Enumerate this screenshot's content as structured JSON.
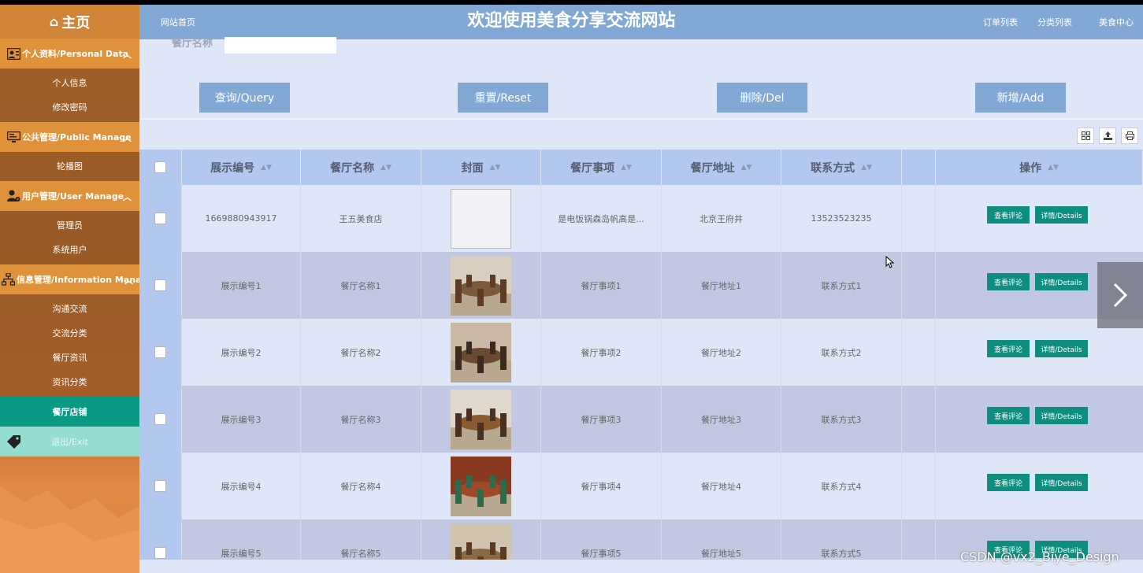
{
  "sidebar": {
    "home": "主页",
    "groups": [
      {
        "title": "个人资料/Personal Data",
        "items": [
          "个人信息",
          "修改密码"
        ]
      },
      {
        "title": "公共管理/Public Manage",
        "items": [
          "轮播图"
        ]
      },
      {
        "title": "用户管理/User Manage",
        "items": [
          "管理员",
          "系统用户"
        ]
      },
      {
        "title": "信息管理/Information Manage",
        "items": [
          "沟通交流",
          "交流分类",
          "餐厅资讯",
          "资讯分类"
        ]
      }
    ],
    "active": "餐厅店铺",
    "exit": "退出/Exit"
  },
  "header": {
    "home_link": "网站首页",
    "title": "欢迎使用美食分享交流网站",
    "links": [
      "订单列表",
      "分类列表",
      "美食中心"
    ]
  },
  "search": {
    "label": "餐厅名称",
    "value": ""
  },
  "buttons": {
    "query": "查询/Query",
    "reset": "重置/Reset",
    "delete": "删除/Del",
    "add": "新增/Add"
  },
  "table": {
    "headers": [
      "展示编号",
      "餐厅名称",
      "封面",
      "餐厅事项",
      "餐厅地址",
      "联系方式",
      "",
      "操作"
    ],
    "rows": [
      {
        "id": "1669880943917",
        "name": "王五美食店",
        "matter": "是电饭锅森岛帆高是...",
        "address": "北京王府井",
        "contact": "13523523235",
        "cover": "broken"
      },
      {
        "id": "展示编号1",
        "name": "餐厅名称1",
        "matter": "餐厅事项1",
        "address": "餐厅地址1",
        "contact": "联系方式1",
        "cover": "dining-room-1"
      },
      {
        "id": "展示编号2",
        "name": "餐厅名称2",
        "matter": "餐厅事项2",
        "address": "餐厅地址2",
        "contact": "联系方式2",
        "cover": "dining-room-2"
      },
      {
        "id": "展示编号3",
        "name": "餐厅名称3",
        "matter": "餐厅事项3",
        "address": "餐厅地址3",
        "contact": "联系方式3",
        "cover": "dining-room-3"
      },
      {
        "id": "展示编号4",
        "name": "餐厅名称4",
        "matter": "餐厅事项4",
        "address": "餐厅地址4",
        "contact": "联系方式4",
        "cover": "dining-room-4"
      },
      {
        "id": "展示编号5",
        "name": "餐厅名称5",
        "matter": "餐厅事项5",
        "address": "餐厅地址5",
        "contact": "联系方式5",
        "cover": "dining-room-5"
      }
    ],
    "actions": {
      "comments": "查看评论",
      "details": "详情/Details"
    }
  },
  "watermark": "CSDN @vx2_Biye_Design",
  "colors": {
    "header": "#82a9d6",
    "sidebar_group": "#e0923a",
    "active": "#0a9a85",
    "action_button": "#0f8e80",
    "row_odd": "#dfe6f8",
    "row_even": "#c3c8e2"
  }
}
